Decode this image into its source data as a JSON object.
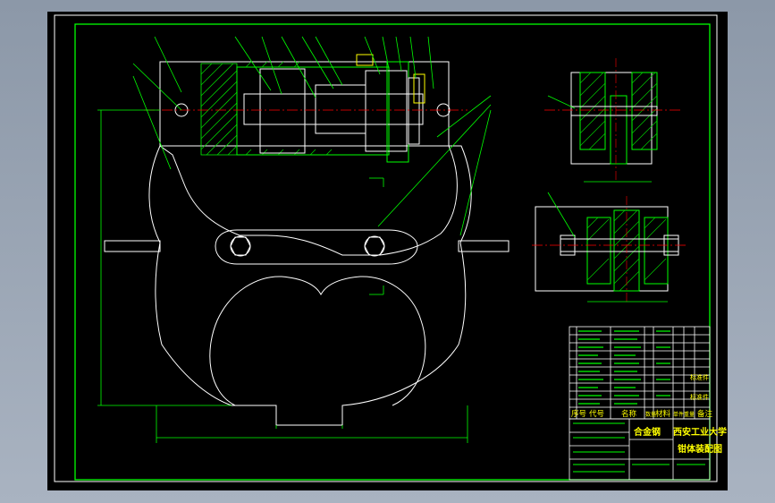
{
  "colors": {
    "background": "#000000",
    "line_white": "#ffffff",
    "line_green": "#00ff00",
    "line_yellow": "#ffff00",
    "centerline_red": "#ff0000",
    "hatch_green": "#00cc00",
    "annotation_gray": "#bfbfbf"
  },
  "title_block": {
    "university": "西安工业大学",
    "material": "合金钢",
    "drawing_title": "钳体装配图",
    "header_cells": [
      "序号",
      "代号",
      "名称",
      "数量",
      "材料",
      "单件重量",
      "总计重量",
      "备注"
    ],
    "remark_1": "标准件",
    "remark_2": "标准件"
  }
}
